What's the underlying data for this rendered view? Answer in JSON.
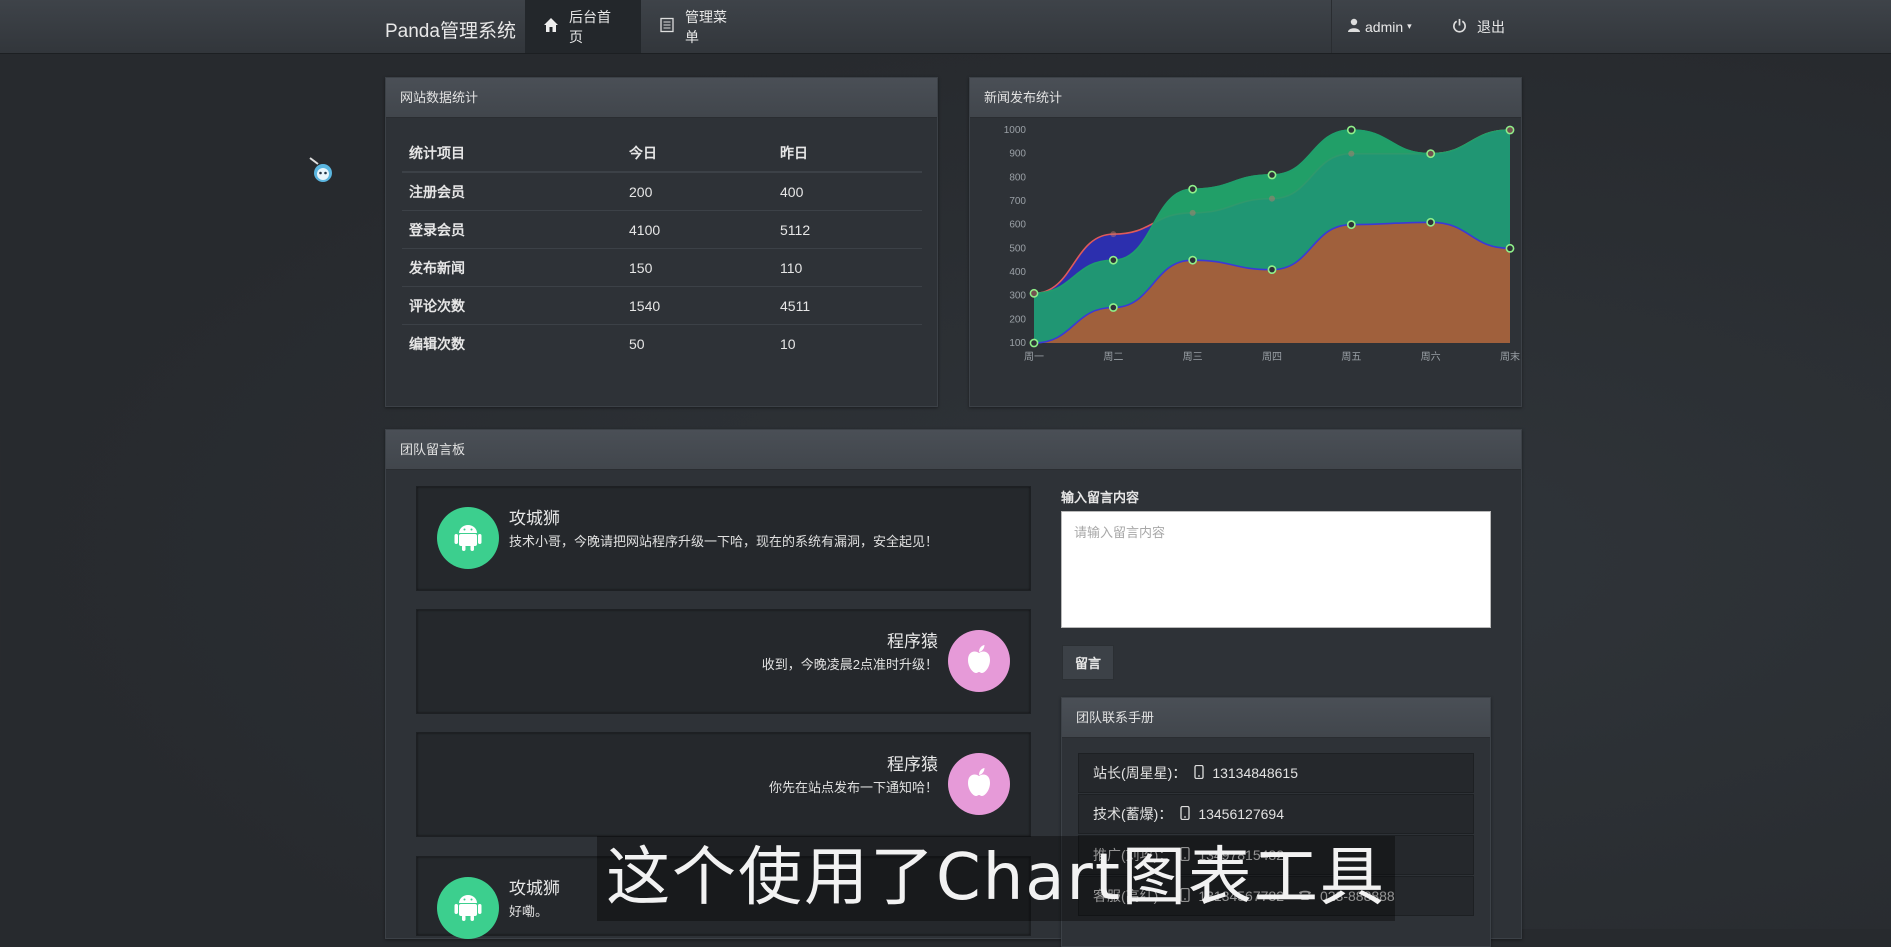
{
  "header": {
    "brand": "Panda管理系统",
    "nav": [
      {
        "label": "后台首页",
        "icon": "home-icon",
        "active": true
      },
      {
        "label": "管理菜单",
        "icon": "list-icon",
        "active": false
      }
    ],
    "user": "admin",
    "logout": "退出"
  },
  "stats_panel": {
    "title": "网站数据统计",
    "columns": [
      "统计项目",
      "今日",
      "昨日"
    ],
    "rows": [
      [
        "注册会员",
        "200",
        "400"
      ],
      [
        "登录会员",
        "4100",
        "5112"
      ],
      [
        "发布新闻",
        "150",
        "110"
      ],
      [
        "评论次数",
        "1540",
        "4511"
      ],
      [
        "编辑次数",
        "50",
        "10"
      ]
    ]
  },
  "chart_panel": {
    "title": "新闻发布统计"
  },
  "chart_data": {
    "type": "area",
    "categories": [
      "周一",
      "周二",
      "周三",
      "周四",
      "周五",
      "周六",
      "周末"
    ],
    "y_ticks": [
      100,
      200,
      300,
      400,
      500,
      600,
      700,
      800,
      900,
      1000
    ],
    "ylim": [
      100,
      1000
    ],
    "series": [
      {
        "values": [
          100,
          250,
          450,
          410,
          600,
          610,
          500
        ],
        "fill": "#a0603c",
        "line": "#3a3ad6"
      },
      {
        "values": [
          310,
          450,
          750,
          810,
          1000,
          900,
          1000
        ],
        "fill": "#1f9e6e",
        "line": "#1f9e6e"
      },
      {
        "values": [
          310,
          560,
          650,
          710,
          900,
          900,
          1000
        ],
        "fill": "#2c2fb8",
        "line": "#e05a5a"
      },
      {
        "values": [
          310,
          450,
          750,
          810,
          1000,
          900,
          1000
        ],
        "fill": "#36b02f",
        "line": "#36b02f"
      }
    ],
    "grid": false
  },
  "board_panel": {
    "title": "团队留言板",
    "messages": [
      {
        "name": "攻城狮",
        "text": "技术小哥，今晚请把网站程序升级一下哈，现在的系统有漏洞，安全起见！",
        "icon": "android-icon",
        "side": "left"
      },
      {
        "name": "程序猿",
        "text": "收到，今晚凌晨2点准时升级！",
        "icon": "apple-icon",
        "side": "right"
      },
      {
        "name": "程序猿",
        "text": "你先在站点发布一下通知哈！",
        "icon": "apple-icon",
        "side": "right"
      },
      {
        "name": "攻城狮",
        "text": "好嘞。",
        "icon": "android-icon",
        "side": "left"
      }
    ],
    "input_label": "输入留言内容",
    "input_placeholder": "请输入留言内容",
    "submit": "留言"
  },
  "contacts_panel": {
    "title": "团队联系手册",
    "rows": [
      {
        "label": "站长(周星星)：",
        "phone": "13134848615"
      },
      {
        "label": "技术(蓄爆)：",
        "phone": "13456127694"
      },
      {
        "label": "推广(刘攻)：",
        "phone": "13497815482"
      },
      {
        "label": "客服(高红)：",
        "phone": "13134567782",
        "tel": "023-888888"
      }
    ]
  },
  "subtitle": "这个使用了Chart图表工具"
}
